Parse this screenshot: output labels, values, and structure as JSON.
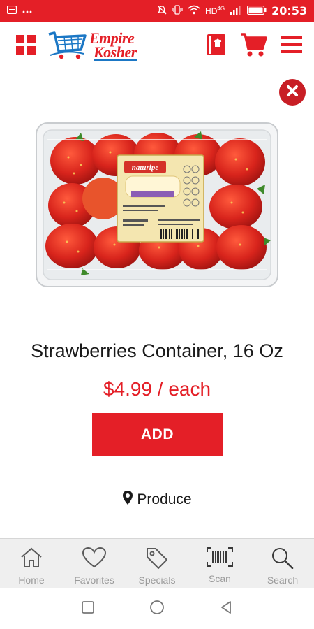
{
  "status_bar": {
    "network": "HD",
    "network_sup": "4G",
    "time": "20:53"
  },
  "header": {
    "logo_line1": "Empire",
    "logo_line2": "Kosher",
    "icons": [
      "grid-icon",
      "recipe-book-icon",
      "cart-icon",
      "menu-icon"
    ]
  },
  "product": {
    "name": "Strawberries Container, 16 Oz",
    "price": "$4.99 / each",
    "add_label": "ADD",
    "department": "Produce",
    "label_brand": "naturipe"
  },
  "bottom_nav": {
    "items": [
      {
        "label": "Home",
        "icon": "home-icon"
      },
      {
        "label": "Favorites",
        "icon": "heart-icon"
      },
      {
        "label": "Specials",
        "icon": "tag-icon"
      },
      {
        "label": "Scan",
        "icon": "barcode-icon"
      },
      {
        "label": "Search",
        "icon": "search-icon"
      }
    ]
  },
  "colors": {
    "brand_red": "#e41f27",
    "brand_blue": "#1b77c5",
    "nav_gray": "#9a9a9a"
  }
}
